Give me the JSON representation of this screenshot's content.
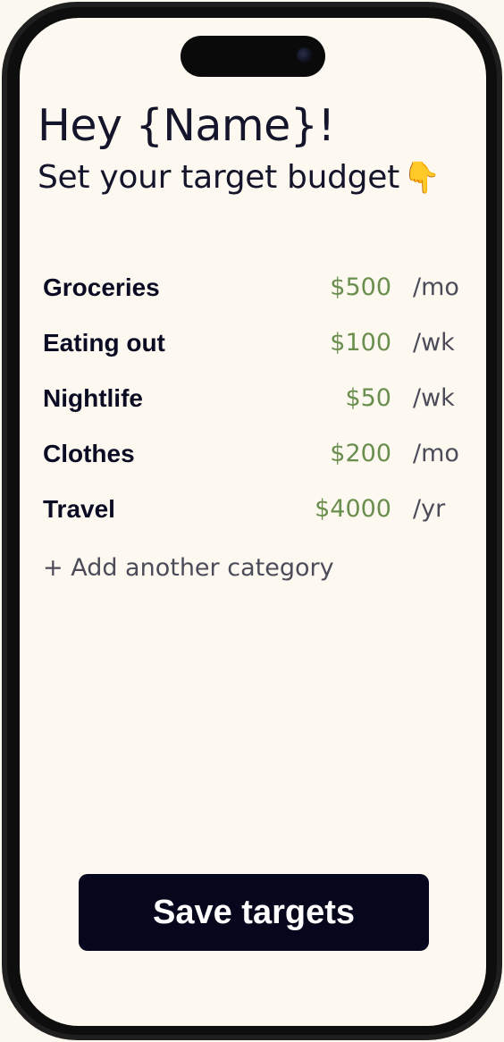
{
  "header": {
    "greeting": "Hey {Name}!",
    "subtitle": "Set your target budget",
    "subtitle_emoji": "👇"
  },
  "budget": {
    "items": [
      {
        "category": "Groceries",
        "amount": "$500",
        "period": "/mo"
      },
      {
        "category": "Eating out",
        "amount": "$100",
        "period": "/wk"
      },
      {
        "category": "Nightlife",
        "amount": "$50",
        "period": "/wk"
      },
      {
        "category": "Clothes",
        "amount": "$200",
        "period": "/mo"
      },
      {
        "category": "Travel",
        "amount": "$4000",
        "period": "/yr"
      }
    ],
    "add_label": "+ Add another category"
  },
  "actions": {
    "save_label": "Save targets"
  },
  "colors": {
    "background": "#fdf9f0",
    "text": "#0b0b24",
    "amount": "#6a8e4e",
    "muted": "#4b4b5a",
    "button": "#06061c"
  }
}
